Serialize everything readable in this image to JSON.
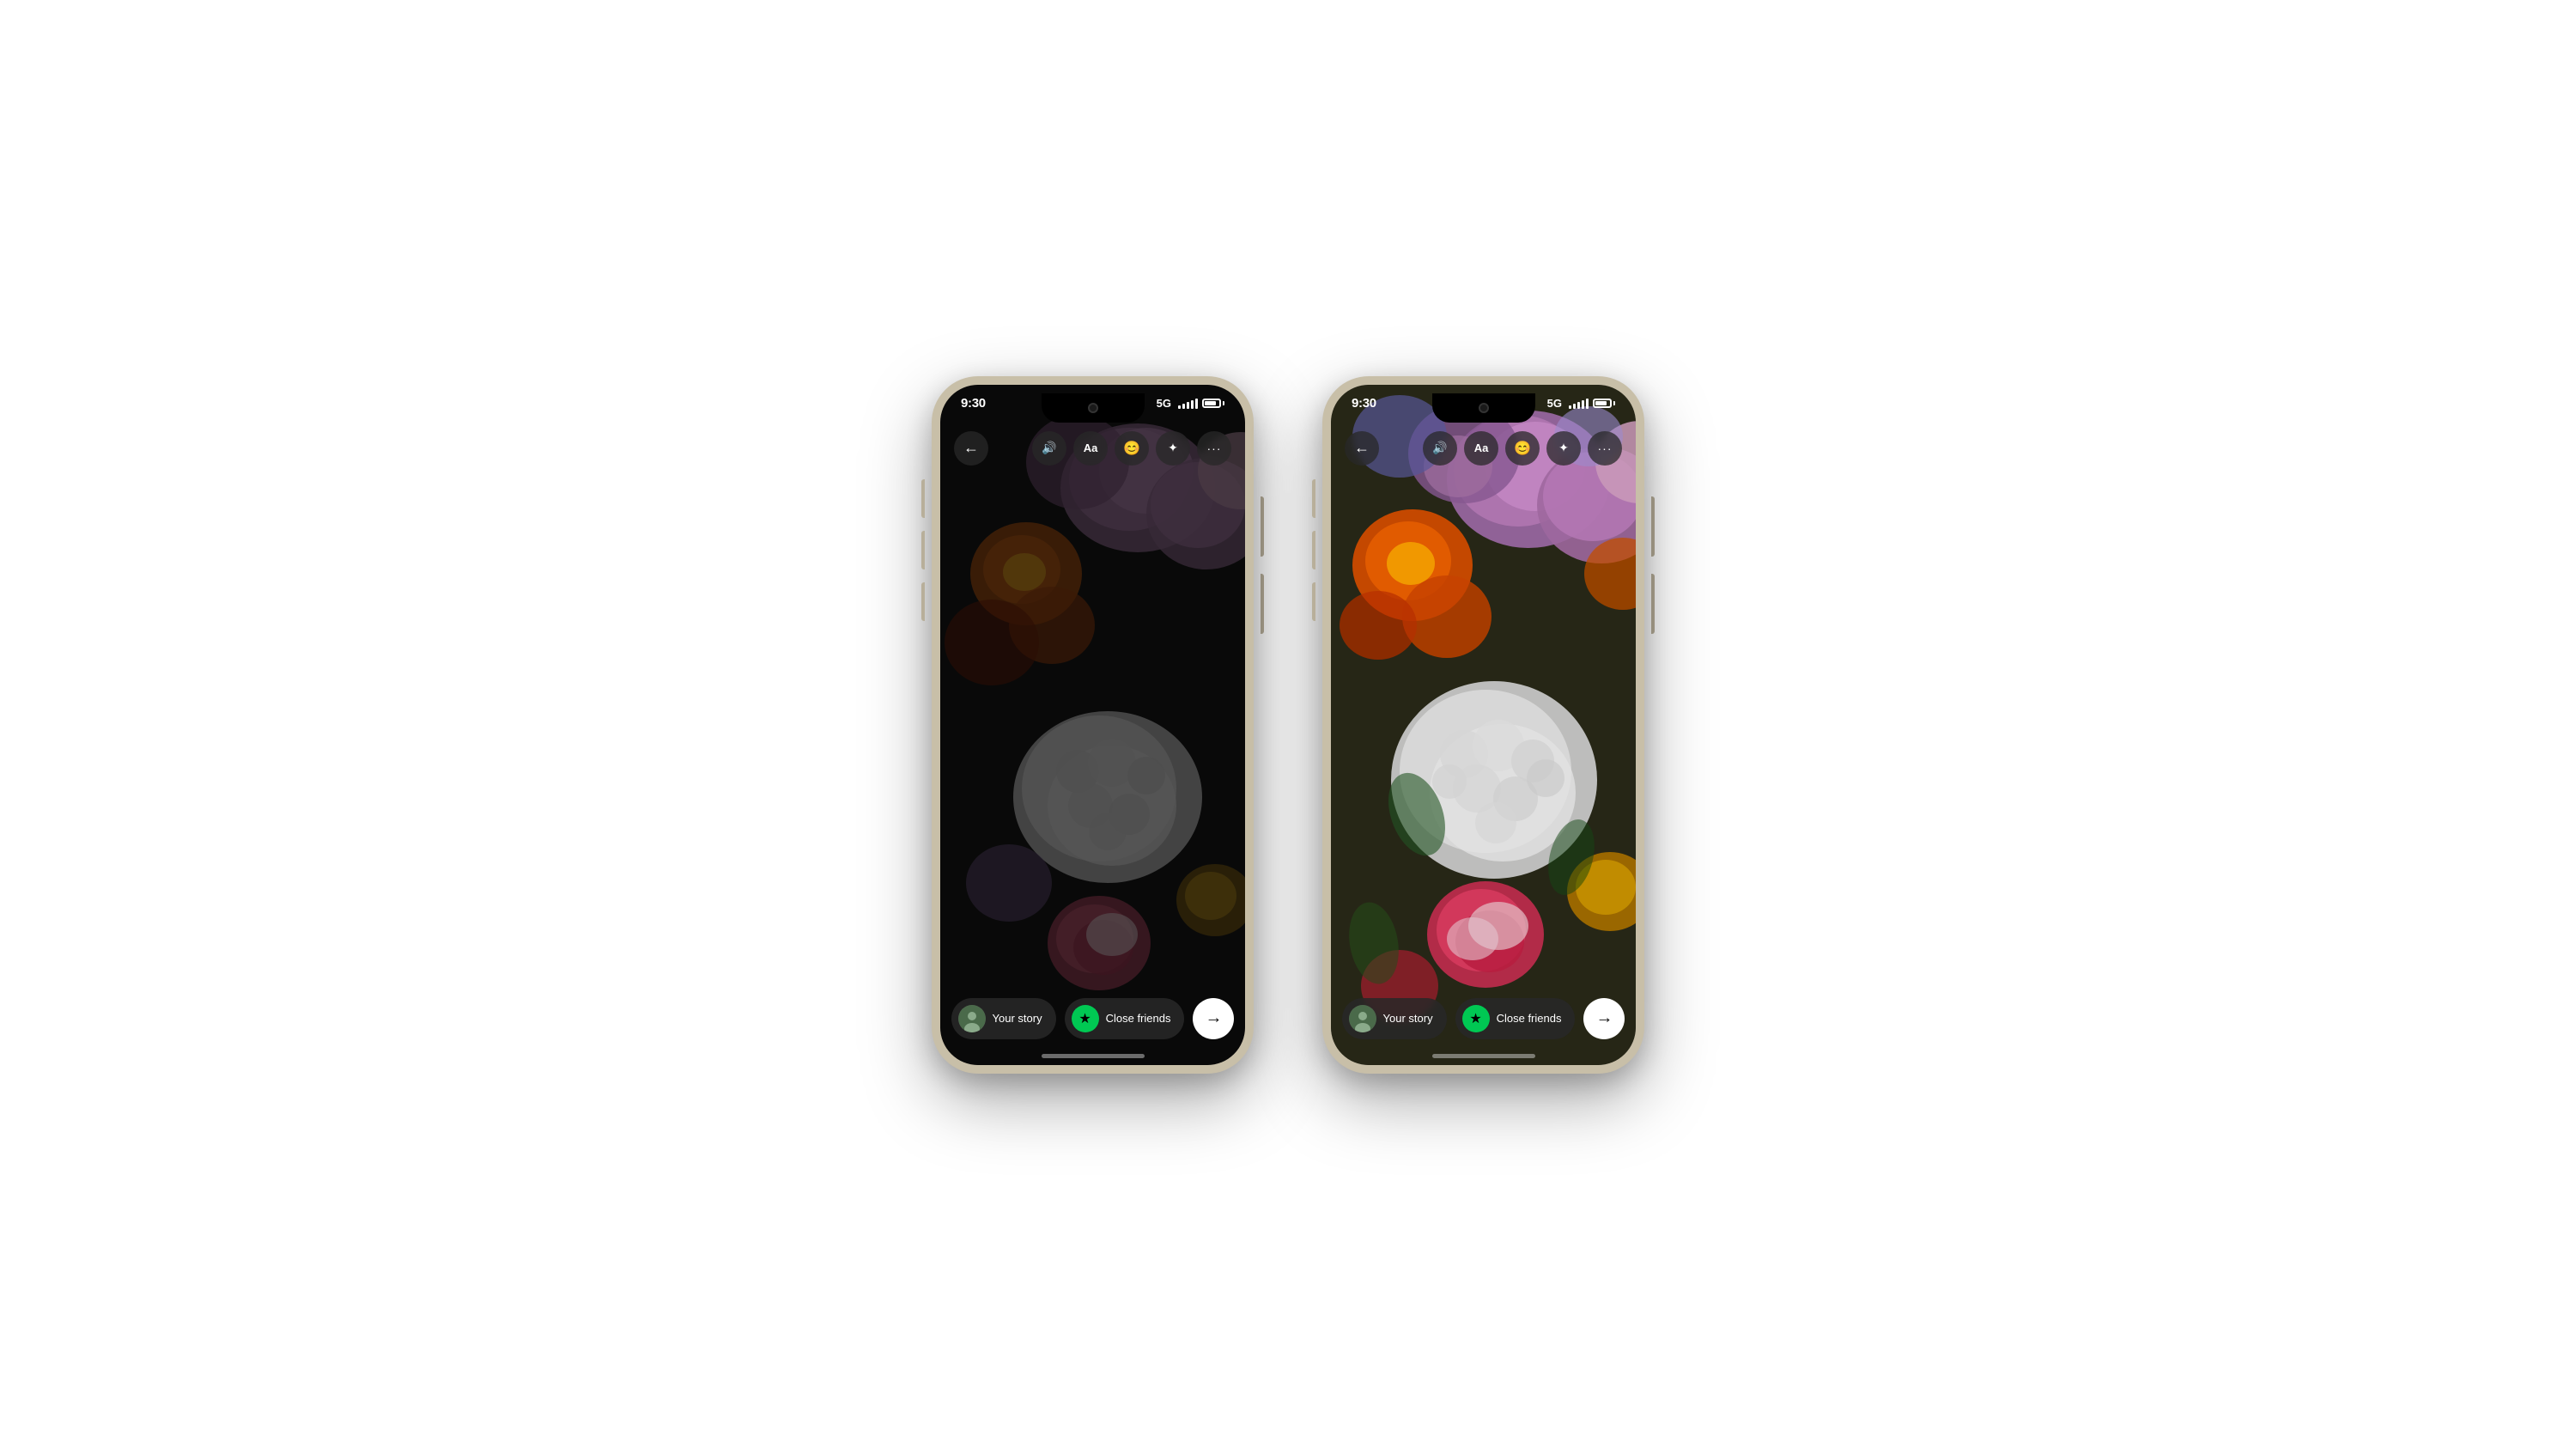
{
  "phones": [
    {
      "id": "phone-dark",
      "status": {
        "time": "9:30",
        "signal": "5G",
        "bars": [
          4,
          6,
          8,
          10,
          12
        ]
      },
      "toolbar": {
        "back_icon": "←",
        "sound_icon": "🔊",
        "text_icon": "Aa",
        "sticker_icon": "😊",
        "sparkle_icon": "✦",
        "more_icon": "•••"
      },
      "bottom": {
        "your_story_label": "Your story",
        "close_friends_label": "Close friends",
        "arrow": "→"
      },
      "brightness": "dark"
    },
    {
      "id": "phone-bright",
      "status": {
        "time": "9:30",
        "signal": "5G",
        "bars": [
          4,
          6,
          8,
          10,
          12
        ]
      },
      "toolbar": {
        "back_icon": "←",
        "sound_icon": "🔊",
        "text_icon": "Aa",
        "sticker_icon": "😊",
        "sparkle_icon": "✦",
        "more_icon": "•••"
      },
      "bottom": {
        "your_story_label": "Your story",
        "close_friends_label": "Close friends",
        "arrow": "→"
      },
      "brightness": "bright"
    }
  ]
}
